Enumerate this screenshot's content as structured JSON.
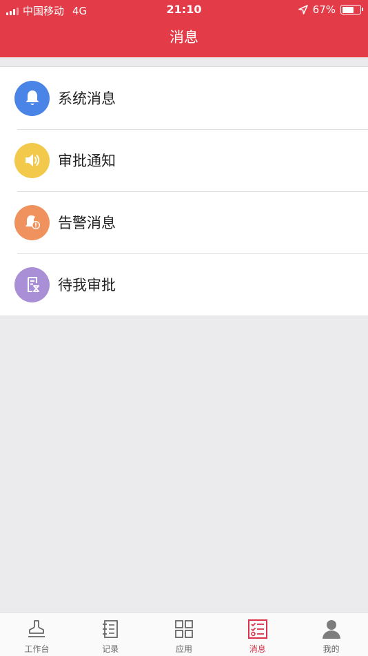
{
  "status_bar": {
    "carrier": "中国移动",
    "network": "4G",
    "time": "21:10",
    "battery": "67%",
    "battery_level": 0.67
  },
  "header": {
    "title": "消息"
  },
  "messages": [
    {
      "label": "系统消息",
      "icon": "bell-icon",
      "color": "#4a84e6"
    },
    {
      "label": "审批通知",
      "icon": "speaker-icon",
      "color": "#f2c94a"
    },
    {
      "label": "告警消息",
      "icon": "alarm-icon",
      "color": "#f0925e"
    },
    {
      "label": "待我审批",
      "icon": "pending-approval-icon",
      "color": "#a98fd6"
    }
  ],
  "tabs": [
    {
      "label": "工作台",
      "icon": "workbench-icon",
      "active": false
    },
    {
      "label": "记录",
      "icon": "notebook-icon",
      "active": false
    },
    {
      "label": "应用",
      "icon": "apps-grid-icon",
      "active": false
    },
    {
      "label": "消息",
      "icon": "message-list-icon",
      "active": true
    },
    {
      "label": "我的",
      "icon": "profile-icon",
      "active": false
    }
  ],
  "colors": {
    "header_bg": "#e33b47",
    "tab_active": "#d9324a",
    "tab_inactive": "#666666",
    "page_bg": "#ebebee"
  }
}
